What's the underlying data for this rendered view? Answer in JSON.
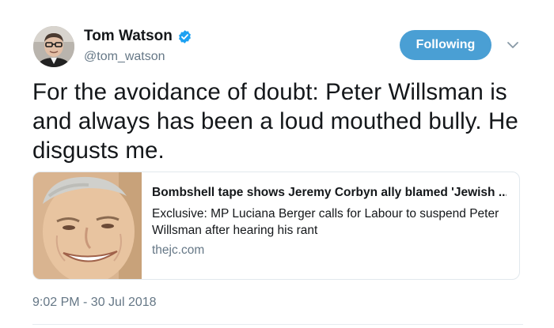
{
  "tweet": {
    "author": {
      "name": "Tom Watson",
      "handle": "@tom_watson",
      "verified": true
    },
    "follow_button_label": "Following",
    "text": "For the avoidance of doubt: Peter Willsman is and always has been a loud mouthed bully. He disgusts me.",
    "card": {
      "title": "Bombshell tape shows Jeremy Corbyn ally blamed 'Jewish ...",
      "description": "Exclusive: MP Luciana Berger calls for Labour to suspend Peter Willsman after hearing his rant",
      "domain": "thejc.com"
    },
    "timestamp": "9:02 PM - 30 Jul 2018"
  },
  "icons": {
    "verified": "verified-badge-icon",
    "caret": "chevron-down-icon"
  },
  "colors": {
    "follow_button": "#4a9fd4",
    "verified_badge": "#1da1f2",
    "secondary_text": "#657786",
    "card_border": "#e1e8ed"
  }
}
